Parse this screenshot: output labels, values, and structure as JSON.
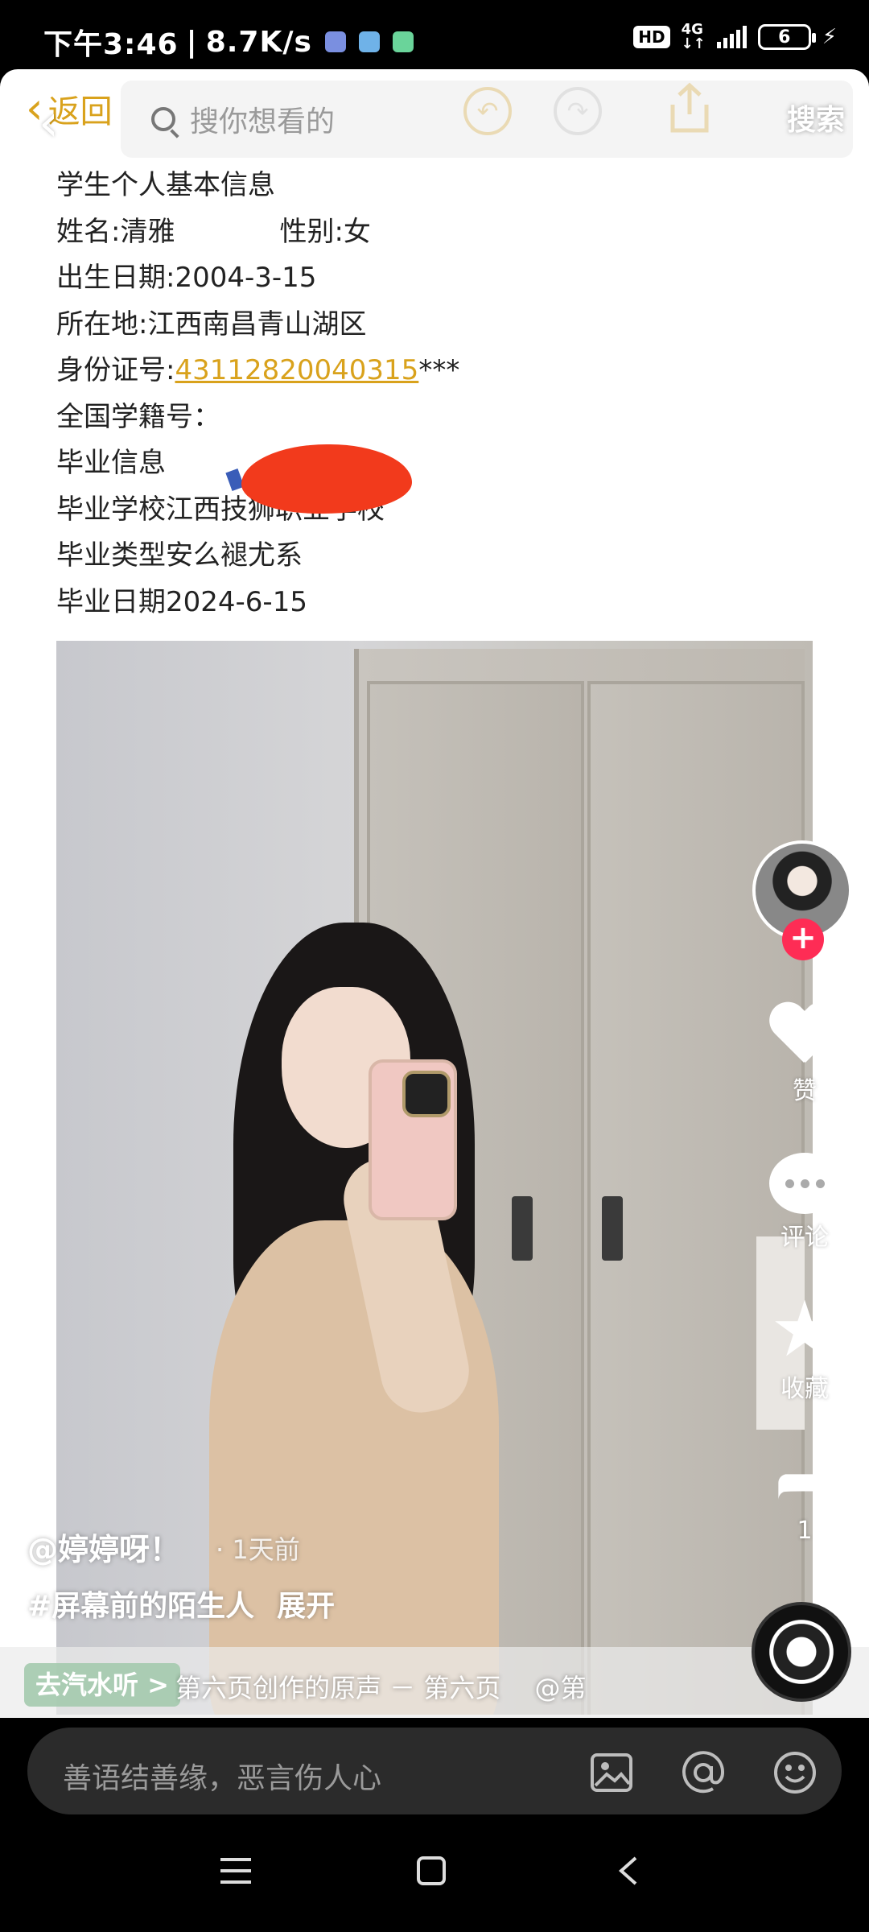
{
  "status_bar": {
    "time": "下午3:46",
    "separator": "|",
    "net_speed": "8.7K/s",
    "hd": "HD",
    "network": "4G",
    "battery": "6"
  },
  "notes_toolbar": {
    "back_label": "返回"
  },
  "search": {
    "placeholder": "搜你想看的",
    "button": "搜索"
  },
  "document": {
    "title": "学生个人基本信息",
    "name": "姓名:清雅",
    "gender": "性别:女",
    "birth": "出生日期:2004-3-15",
    "location": "所在地:江西南昌青山湖区",
    "id_label": "身份证号:",
    "id_value": "43112820040315",
    "id_mask": "***",
    "student_no_label": "全国学籍号：",
    "grad_heading": "毕业信息",
    "grad_school": "毕业学校江西技狮职业学校",
    "grad_type": "毕业类型安么褪尤系",
    "grad_date": "毕业日期2024-6-15"
  },
  "rail": {
    "like_label": "赞",
    "comment_label": "评论",
    "favorite_label": "收藏",
    "share_count": "1"
  },
  "video": {
    "author": "@婷婷呀！",
    "time_ago": "· 1天前",
    "hashtag": "#屏幕前的陌生人",
    "expand": "展开",
    "listen_button": "去汽水听 >",
    "music_text": "第六页创作的原声 － 第六页　 @第"
  },
  "comment_bar": {
    "placeholder": "善语结善缘，恶言伤人心"
  },
  "colors": {
    "accent_gold": "#d9a21c",
    "follow_red": "#fe2c55",
    "redaction_red": "#f23a1c"
  }
}
